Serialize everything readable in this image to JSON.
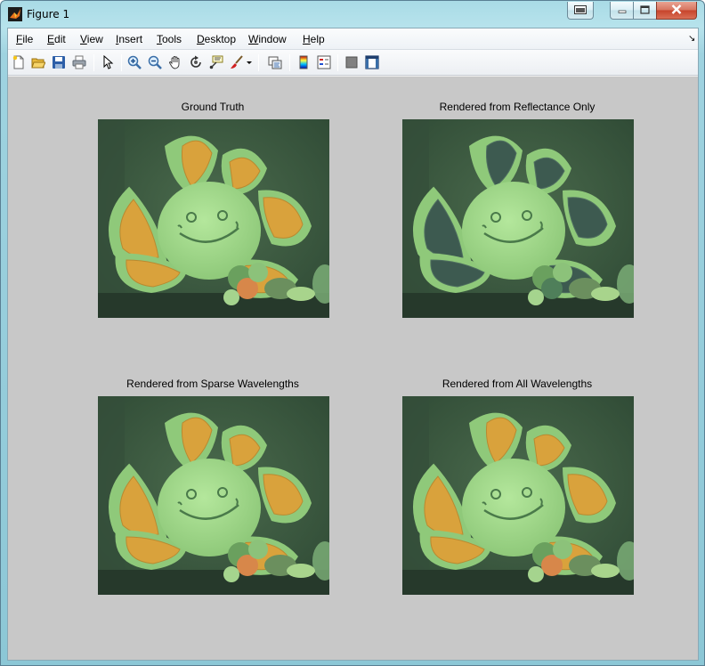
{
  "window": {
    "title": "Figure 1"
  },
  "menu": [
    "File",
    "Edit",
    "View",
    "Insert",
    "Tools",
    "Desktop",
    "Window",
    "Help"
  ],
  "menu_mnemonics": [
    "F",
    "E",
    "V",
    "I",
    "T",
    "D",
    "W",
    "H"
  ],
  "toolbar": [
    {
      "name": "new-figure-icon"
    },
    {
      "name": "open-file-icon"
    },
    {
      "name": "save-figure-icon"
    },
    {
      "name": "print-figure-icon"
    },
    {
      "name": "edit-plot-arrow-icon"
    },
    {
      "name": "zoom-in-icon"
    },
    {
      "name": "zoom-out-icon"
    },
    {
      "name": "pan-hand-icon"
    },
    {
      "name": "rotate-3d-icon"
    },
    {
      "name": "data-cursor-icon"
    },
    {
      "name": "brush-icon"
    },
    {
      "name": "link-plot-icon"
    },
    {
      "name": "insert-colorbar-icon"
    },
    {
      "name": "insert-legend-icon"
    },
    {
      "name": "hide-plot-tools-icon"
    },
    {
      "name": "show-plot-tools-icon"
    }
  ],
  "subplots": [
    {
      "title": "Ground Truth",
      "variant": "truth"
    },
    {
      "title": "Rendered from Reflectance Only",
      "variant": "reflectance"
    },
    {
      "title": "Rendered from Sparse Wavelengths",
      "variant": "sparse"
    },
    {
      "title": "Rendered from All Wavelengths",
      "variant": "all"
    }
  ],
  "colors": {
    "canvas_bg": "#c8c8c8",
    "image_dark_green": "#2f4a35",
    "toy_green": "#8fc97a",
    "petal_orange": "#d9a23c",
    "petal_dark": "#3d5a50"
  }
}
